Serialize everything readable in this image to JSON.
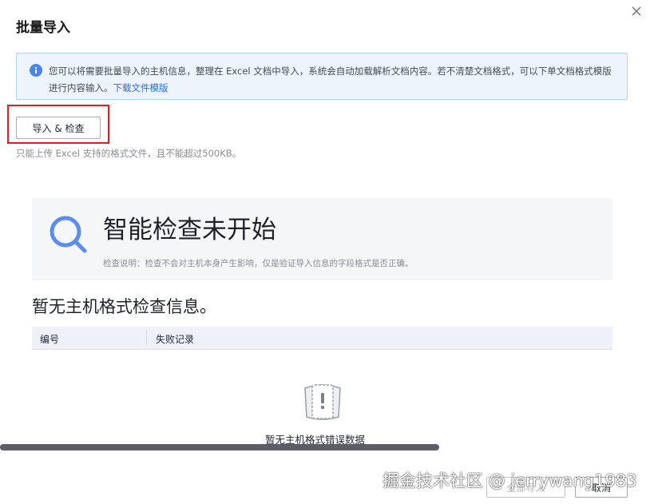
{
  "dialog": {
    "title": "批量导入"
  },
  "info_banner": {
    "text": "您可以将需要批量导入的主机信息，整理在 Excel 文档中导入，系统会自动加载解析文档内容。若不清楚文档格式，可以下单文档格式模版进行内容输入。",
    "link": "下载文件模版",
    "icon": "info-icon"
  },
  "upload": {
    "button_label": "导入 & 检查",
    "hint": "只能上传 Excel 支持的格式文件，且不能超过500KB。"
  },
  "check": {
    "title": "智能检查未开始",
    "description": "检查说明：检查不会对主机本身产生影响，仅是验证导入信息的字段格式是否正确。",
    "icon": "magnifier-icon"
  },
  "result": {
    "heading": "暂无主机格式检查信息。",
    "columns": [
      "编号",
      "失败记录"
    ],
    "empty_text": "暂无主机格式错误数据"
  },
  "footer": {
    "import_all_label": "全部导入",
    "cancel_label": "取消"
  },
  "watermark": "掘金技术社区 @ jerrywang1983",
  "colors": {
    "accent": "#2b6fd6",
    "highlight": "#e02020",
    "magnifier": "#5b8def"
  }
}
